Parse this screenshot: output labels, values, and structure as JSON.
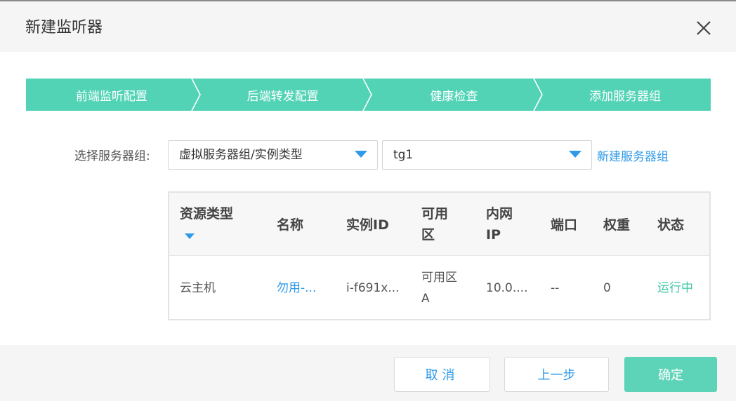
{
  "dialog": {
    "title": "新建监听器",
    "close_icon": "close-icon"
  },
  "steps": [
    {
      "label": "前端监听配置"
    },
    {
      "label": "后端转发配置"
    },
    {
      "label": "健康检查"
    },
    {
      "label": "添加服务器组"
    }
  ],
  "colors": {
    "accent": "#52d3b6",
    "link": "#2f9ae8",
    "status_running": "#3cc7a4"
  },
  "server_group": {
    "label": "选择服务器组:",
    "type_select_value": "虚拟服务器组/实例类型",
    "group_select_value": "tg1",
    "new_group_link": "新建服务器组"
  },
  "table": {
    "headers": {
      "resource_type": "资源类型",
      "name": "名称",
      "instance_id": "实例ID",
      "zone_line1": "可用",
      "zone_line2": "区",
      "ip_line1": "内网",
      "ip_line2": "IP",
      "port": "端口",
      "weight": "权重",
      "status": "状态"
    },
    "rows": [
      {
        "resource_type": "云主机",
        "name": "勿用-...",
        "instance_id": "i-f691x...",
        "zone_line1": "可用区",
        "zone_line2": "A",
        "ip": "10.0....",
        "port": "--",
        "weight": "0",
        "status": "运行中"
      }
    ]
  },
  "footer": {
    "cancel_label": "取消",
    "prev_label": "上一步",
    "ok_label": "确定"
  }
}
